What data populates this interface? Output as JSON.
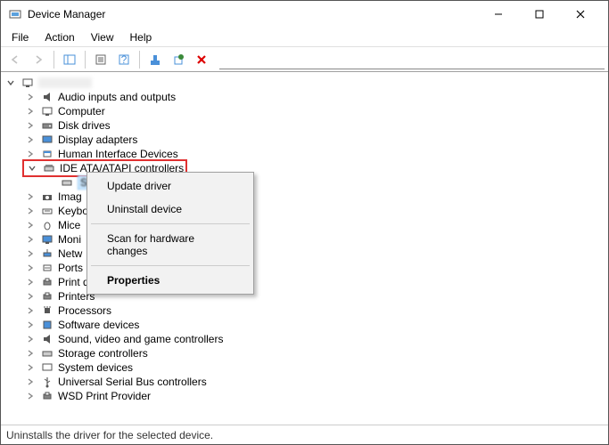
{
  "window": {
    "title": "Device Manager"
  },
  "menubar": {
    "file": "File",
    "action": "Action",
    "view": "View",
    "help": "Help"
  },
  "tree": {
    "root_label": "",
    "nodes": {
      "audio": "Audio inputs and outputs",
      "computer": "Computer",
      "disk": "Disk drives",
      "display": "Display adapters",
      "hid": "Human Interface Devices",
      "ide": "IDE ATA/ATAPI controllers",
      "ide_child": "Standard SATA AHCI Controller",
      "imaging": "Imag",
      "keyboard": "Keybo",
      "mice": "Mice",
      "monitors": "Moni",
      "network": "Netw",
      "ports": "Ports (COM & LPT)",
      "printq": "Print queues",
      "printers": "Printers",
      "processors": "Processors",
      "software": "Software devices",
      "sound": "Sound, video and game controllers",
      "storage": "Storage controllers",
      "system": "System devices",
      "usb": "Universal Serial Bus controllers",
      "wsd": "WSD Print Provider"
    }
  },
  "context_menu": {
    "update": "Update driver",
    "uninstall": "Uninstall device",
    "scan": "Scan for hardware changes",
    "properties": "Properties"
  },
  "statusbar": {
    "text": "Uninstalls the driver for the selected device."
  }
}
